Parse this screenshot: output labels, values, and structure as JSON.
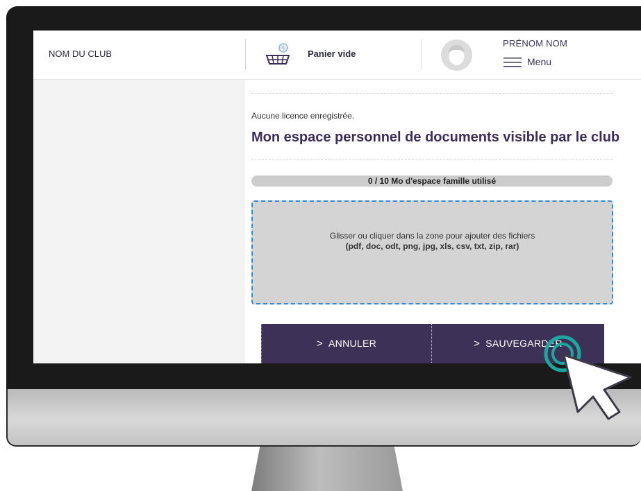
{
  "header": {
    "club_name": "NOM DU CLUB",
    "cart_label": "Panier vide",
    "cart_icon": "basket-icon",
    "user_name": "PRÉNOM NOM",
    "menu_label": "Menu",
    "menu_icon": "hamburger-icon",
    "avatar_icon": "user-avatar-icon"
  },
  "main": {
    "licence_text": "Aucune licence enregistrée.",
    "title": "Mon espace personnel de documents visible par le club",
    "storage": {
      "text": "0 / 10 Mo d'espace famille utilisé",
      "used_fraction": 0
    },
    "dropzone": {
      "line1": "Glisser ou cliquer dans la zone pour ajouter des fichiers",
      "line2": "(pdf, doc, odt, png, jpg, xls, csv, txt, zip, rar)"
    },
    "buttons": {
      "cancel_label": "ANNULER",
      "save_label": "SAUVEGARDER"
    }
  },
  "colors": {
    "primary": "#3d3158",
    "title": "#3b2e5a",
    "dropzone_border": "#2f8bd8",
    "click_ring": "#1aa9a0"
  }
}
